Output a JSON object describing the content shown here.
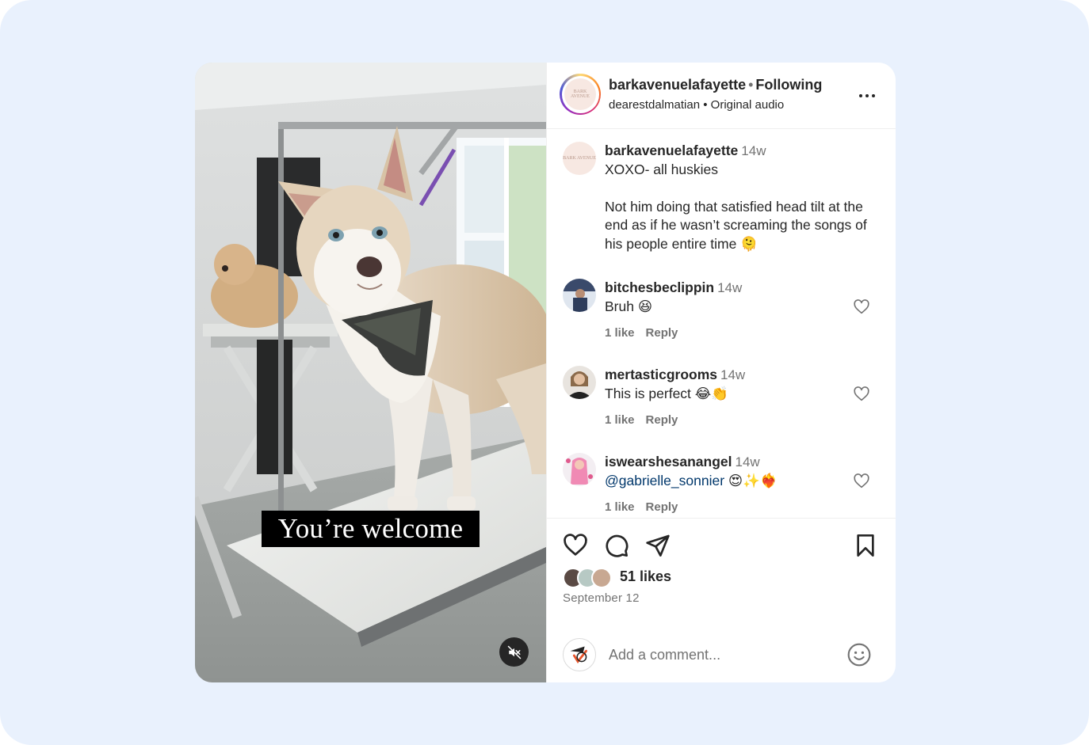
{
  "video": {
    "caption_overlay": "You’re welcome",
    "mute_icon": "speaker-muted-icon"
  },
  "header": {
    "username": "barkavenuelafayette",
    "separator": "•",
    "follow_label": "Following",
    "audio_line": "dearestdalmatian • Original audio",
    "avatar_logo": "BARK AVENUE"
  },
  "caption": {
    "username": "barkavenuelafayette",
    "time": "14w",
    "line1": "XOXO- all huskies",
    "line2": "Not him doing that satisfied head tilt at the end as if he wasn’t screaming the songs of his people entire time 🫠"
  },
  "comments": [
    {
      "username": "bitchesbeclippin",
      "time": "14w",
      "text": "Bruh 😆",
      "mention": "",
      "likes": "1 like",
      "reply": "Reply"
    },
    {
      "username": "mertasticgrooms",
      "time": "14w",
      "text": "This is perfect 😂👏",
      "mention": "",
      "likes": "1 like",
      "reply": "Reply"
    },
    {
      "username": "iswearshesanangel",
      "time": "14w",
      "text": " 😍✨❤️‍🔥",
      "mention": "@gabrielle_sonnier",
      "likes": "1 like",
      "reply": "Reply"
    }
  ],
  "actions": {
    "likes_label": "51 likes",
    "date": "September 12"
  },
  "composer": {
    "placeholder": "Add a comment..."
  },
  "colors": {
    "link": "#00376b",
    "secondary_text": "#737373",
    "primary_text": "#262626",
    "backdrop": "#e9f1fd"
  }
}
